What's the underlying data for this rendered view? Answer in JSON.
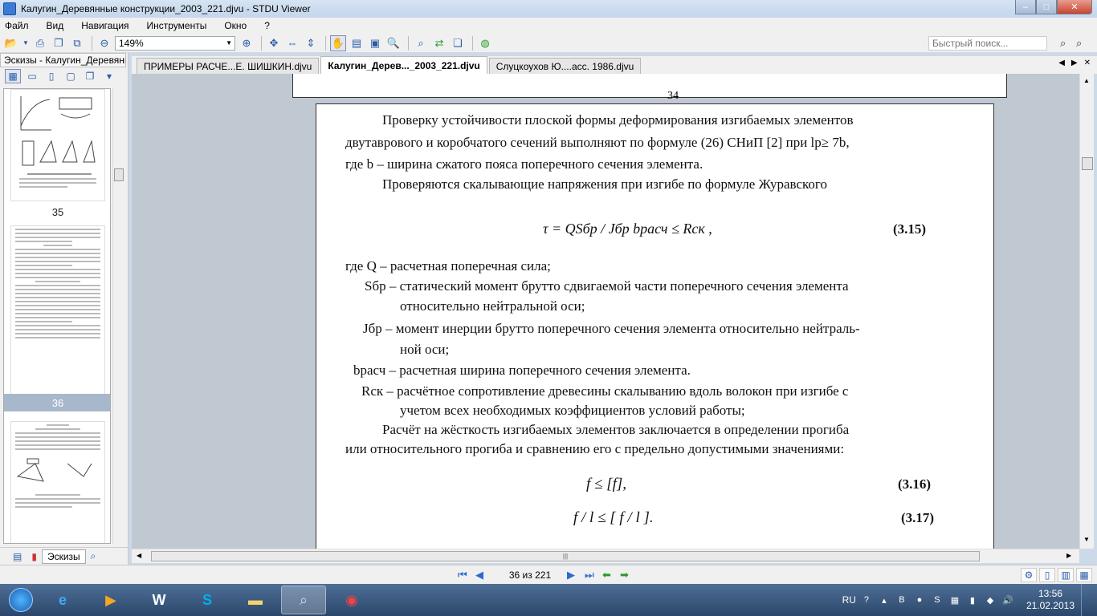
{
  "window": {
    "title": "Калугин_Деревянные конструкции_2003_221.djvu - STDU Viewer",
    "min": "–",
    "max": "□",
    "close": "✕"
  },
  "menu": [
    "Файл",
    "Вид",
    "Навигация",
    "Инструменты",
    "Окно",
    "?"
  ],
  "toolbar": {
    "zoom": "149%",
    "search_placeholder": "Быстрый поиск..."
  },
  "sidebar": {
    "title": "Эскизы - Калугин_Деревянные конструкции",
    "pages": [
      {
        "label": "35",
        "selected": false
      },
      {
        "label": "36",
        "selected": true
      }
    ],
    "bottom_tab": "Эскизы"
  },
  "tabs": [
    {
      "label": "ПРИМЕРЫ РАСЧЕ...Е. ШИШКИН.djvu",
      "active": false
    },
    {
      "label": "Калугин_Дерев..._2003_221.djvu",
      "active": true
    },
    {
      "label": "Слуцкоухов Ю....асс. 1986.djvu",
      "active": false
    }
  ],
  "document": {
    "prev_page_number": "34",
    "lines": [
      "Проверку устойчивости плоской формы деформирования изгибаемых элементов",
      "двутаврового и коробчатого сечений выполняют по формуле (26) СНиП [2] при lр≥ 7b,",
      "где b – ширина сжатого пояса поперечного сечения элемента.",
      "Проверяются скалывающие напряжения при изгибе по формуле Журавского",
      "τ = QSбр / Jбр bрасч ≤ Rск ,",
      "(3.15)",
      "где  Q  – расчетная поперечная сила;",
      "Sбр – статический  момент  брутто  сдвигаемой части поперечного сечения элемента",
      "относительно  нейтральной оси;",
      "Jбр – момент инерции брутто поперечного сечения элемента относительно нейтраль-",
      "ной оси;",
      "bрасч – расчетная ширина поперечного сечения элемента.",
      "Rск – расчётное сопротивление древесины скалыванию вдоль волокон при изгибе с",
      "учетом всех необходимых коэффициентов условий работы;",
      "Расчёт на  жёсткость изгибаемых элементов заключается в определении прогиба",
      "или относительного прогиба и сравнению его с предельно допустимыми значениями:",
      "f ≤ [f],",
      "(3.16)",
      "f / l ≤ [ f / l ].",
      "(3.17)"
    ]
  },
  "status": {
    "page_indicator": "36 из 221"
  },
  "tray": {
    "lang": "RU",
    "time": "13:56",
    "date": "21.02.2013"
  }
}
